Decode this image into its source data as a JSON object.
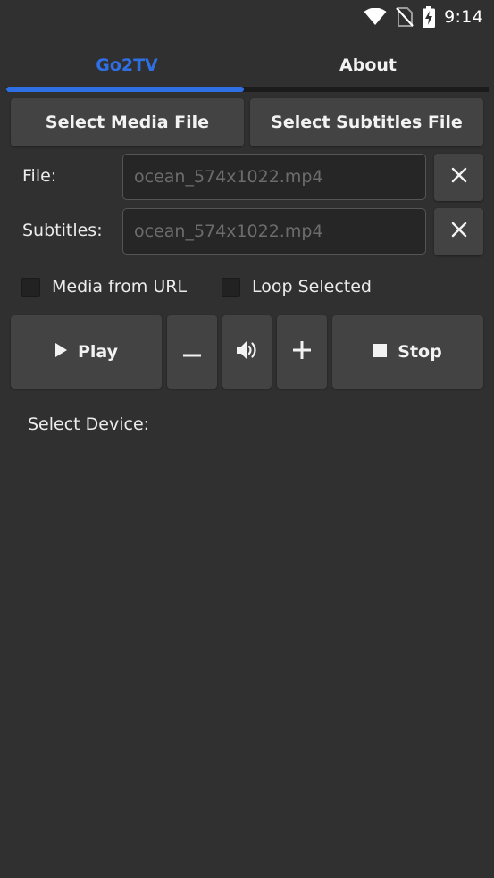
{
  "status_bar": {
    "time": "9:14",
    "icons": [
      "wifi-icon",
      "no-sim-icon",
      "battery-charging-icon"
    ]
  },
  "tabs": [
    {
      "label": "Go2TV",
      "selected": true
    },
    {
      "label": "About",
      "selected": false
    }
  ],
  "buttons": {
    "select_media": "Select Media File",
    "select_subtitles": "Select Subtitles File"
  },
  "fields": {
    "file_label": "File:",
    "file_placeholder": "ocean_574x1022.mp4",
    "subtitles_label": "Subtitles:",
    "subtitles_placeholder": "ocean_574x1022.mp4"
  },
  "options": {
    "media_from_url": "Media from URL",
    "loop_selected": "Loop Selected"
  },
  "controls": {
    "play": "Play",
    "stop": "Stop"
  },
  "device": {
    "label": "Select Device:"
  },
  "colors": {
    "accent": "#2f6fe4",
    "background": "#303030",
    "button": "#434343"
  }
}
